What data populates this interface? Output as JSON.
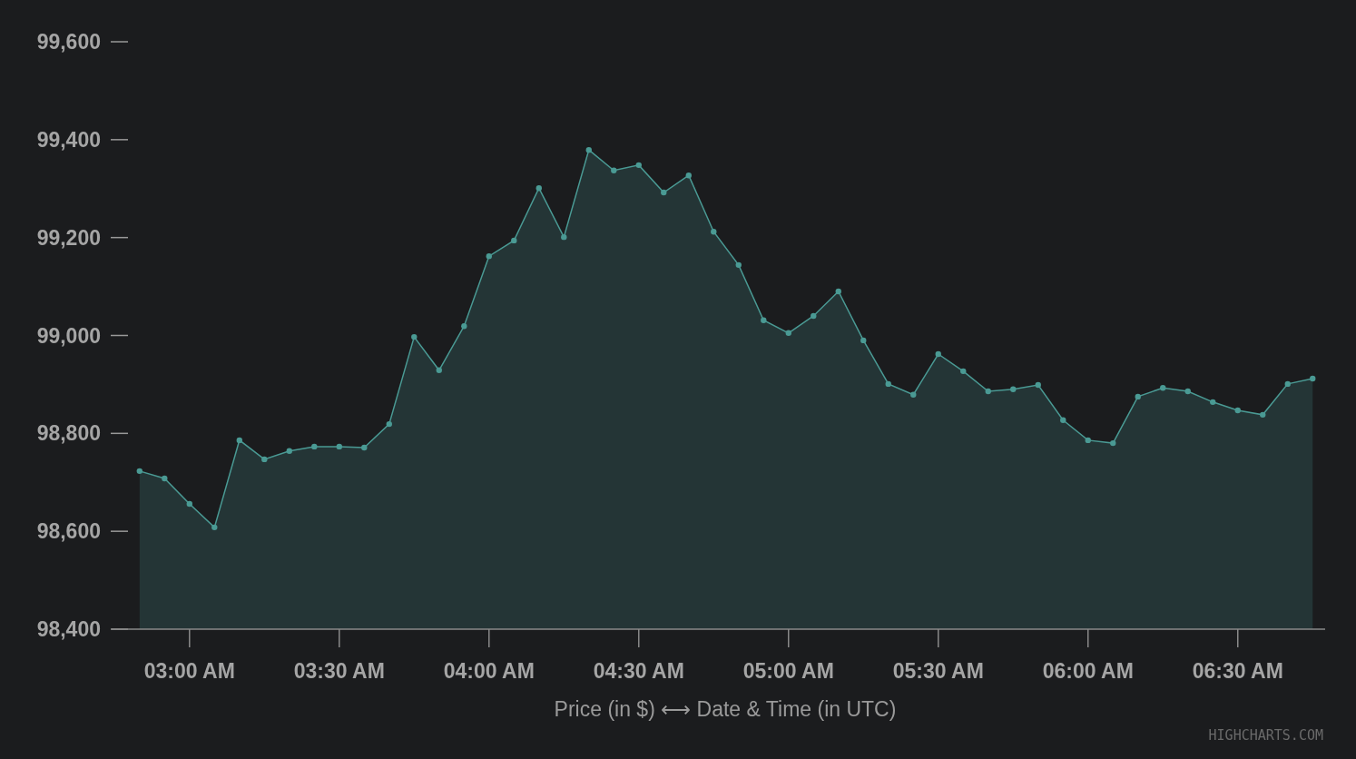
{
  "chart": {
    "chart_data": {
      "type": "area",
      "xlabel": "Price (in $) ⟷ Date & Time (in UTC)",
      "x": [
        170,
        175,
        180,
        185,
        190,
        195,
        200,
        205,
        210,
        215,
        220,
        225,
        230,
        235,
        240,
        245,
        250,
        255,
        260,
        265,
        270,
        275,
        280,
        285,
        290,
        295,
        300,
        305,
        310,
        315,
        320,
        325,
        330,
        335,
        340,
        345,
        350,
        355,
        360,
        365,
        370,
        375,
        380,
        385,
        390,
        395,
        400,
        405
      ],
      "series": [
        {
          "color": "#4a9a94",
          "values": [
            98723,
            98708,
            98656,
            98608,
            98786,
            98747,
            98764,
            98773,
            98773,
            98771,
            98819,
            98997,
            98929,
            99019,
            99162,
            99194,
            99301,
            99201,
            99379,
            99337,
            99348,
            99292,
            99327,
            99212,
            99144,
            99031,
            99005,
            99040,
            99090,
            98990,
            98901,
            98879,
            98962,
            98927,
            98886,
            98890,
            98899,
            98827,
            98786,
            98780,
            98875,
            98893,
            98886,
            98864,
            98847,
            98838,
            98901,
            98912
          ]
        }
      ],
      "xlim": [
        164.4,
        407.5
      ],
      "ylim": [
        98400,
        99600
      ],
      "xticks": [
        {
          "value": 180,
          "label": "03:00 AM"
        },
        {
          "value": 210,
          "label": "03:30 AM"
        },
        {
          "value": 240,
          "label": "04:00 AM"
        },
        {
          "value": 270,
          "label": "04:30 AM"
        },
        {
          "value": 300,
          "label": "05:00 AM"
        },
        {
          "value": 330,
          "label": "05:30 AM"
        },
        {
          "value": 360,
          "label": "06:00 AM"
        },
        {
          "value": 390,
          "label": "06:30 AM"
        }
      ],
      "yticks": [
        {
          "value": 98400,
          "label": "98,400"
        },
        {
          "value": 98600,
          "label": "98,600"
        },
        {
          "value": 98800,
          "label": "98,800"
        },
        {
          "value": 99000,
          "label": "99,000"
        },
        {
          "value": 99200,
          "label": "99,200"
        },
        {
          "value": 99400,
          "label": "99,400"
        },
        {
          "value": 99600,
          "label": "99,600"
        }
      ]
    },
    "credit": "HIGHCHARTS.COM"
  }
}
